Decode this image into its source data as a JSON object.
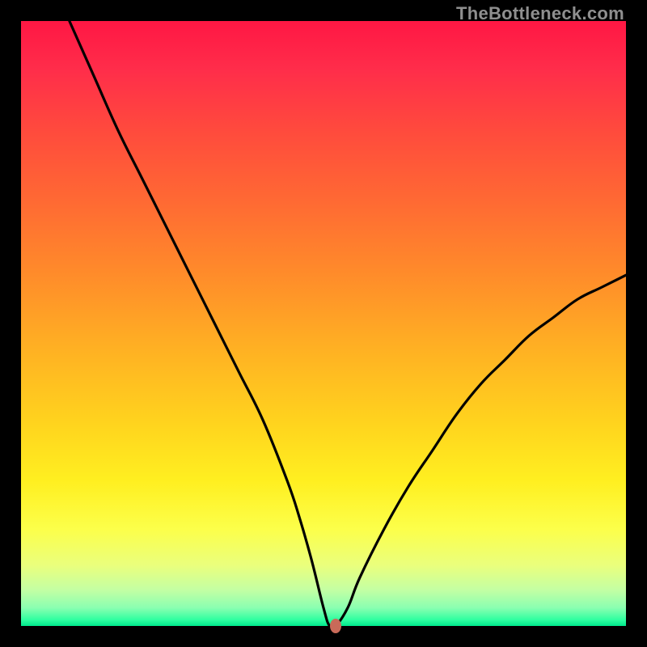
{
  "watermark": "TheBottleneck.com",
  "chart_data": {
    "type": "line",
    "title": "",
    "xlabel": "",
    "ylabel": "",
    "xlim": [
      0,
      100
    ],
    "ylim": [
      0,
      100
    ],
    "x": [
      8,
      12,
      16,
      20,
      24,
      28,
      32,
      36,
      40,
      44,
      46,
      48,
      50,
      51,
      52,
      54,
      56,
      60,
      64,
      68,
      72,
      76,
      80,
      84,
      88,
      92,
      96,
      100
    ],
    "values": [
      100,
      91,
      82,
      74,
      66,
      58,
      50,
      42,
      34,
      24,
      18,
      11,
      3,
      0,
      0,
      3,
      8,
      16,
      23,
      29,
      35,
      40,
      44,
      48,
      51,
      54,
      56,
      58
    ],
    "marker": {
      "x": 52,
      "y": 0
    },
    "gradient_colors": {
      "top": "#ff1744",
      "mid": "#ffd21e",
      "bottom": "#00e88c"
    }
  }
}
